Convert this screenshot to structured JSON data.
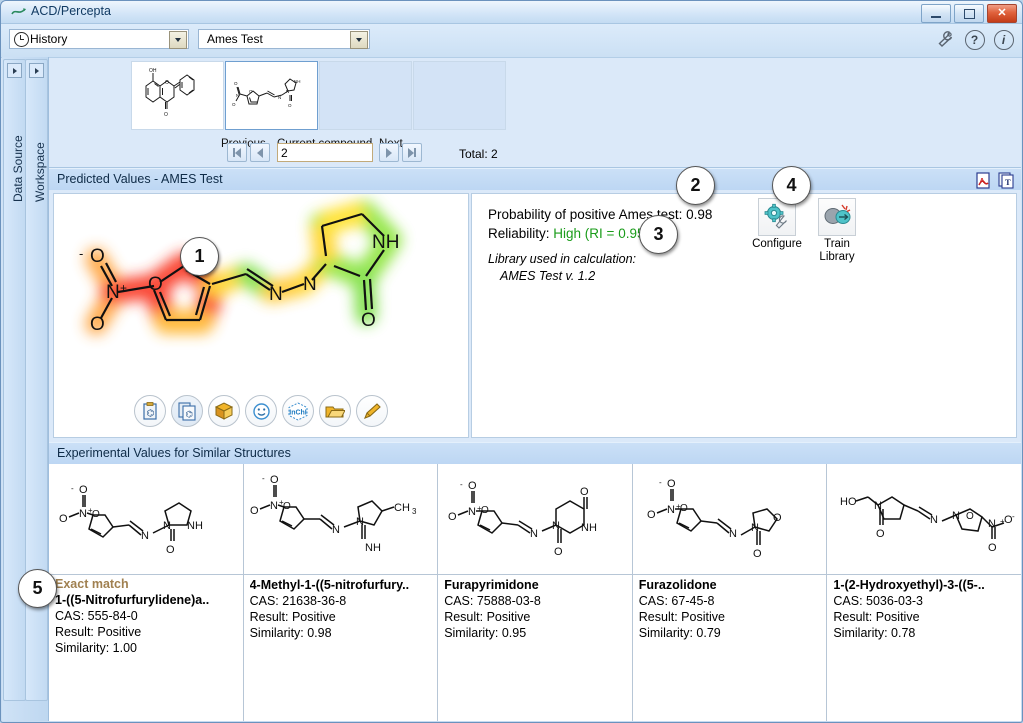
{
  "window": {
    "title": "ACD/Percepta",
    "buttons": {
      "minimize": "minimize",
      "maximize": "maximize",
      "close": "close"
    }
  },
  "toolbar": {
    "history_combo": "History",
    "test_combo": "Ames Test",
    "icons": [
      "wrench-icon",
      "help-icon",
      "info-icon"
    ]
  },
  "side_tabs": [
    {
      "label": "Data Source",
      "name": "sidebar-tab-data-source"
    },
    {
      "label": "Workspace",
      "name": "sidebar-tab-workspace"
    }
  ],
  "compound_strip": {
    "thumbnails": [
      {
        "name": "compound-thumbnail-1",
        "selected": false
      },
      {
        "name": "compound-thumbnail-2",
        "selected": true
      },
      {
        "name": "compound-thumbnail-3",
        "selected": false
      },
      {
        "name": "compound-thumbnail-4",
        "selected": false
      }
    ],
    "previous_label": "Previous",
    "current_label": "Current compound",
    "next_label": "Next",
    "current_value": "2",
    "total": "Total: 2"
  },
  "predicted_panel": {
    "title": "Predicted Values - AMES Test",
    "export_icons": [
      "pdf-export-icon",
      "report-export-icon"
    ],
    "probability_label": "Probability of positive Ames test:",
    "probability_value": "0.98",
    "reliability_label": "Reliability:",
    "reliability_value": "High (RI = 0.95)",
    "reliability_color": "#1a9c1a",
    "library_label": "Library used in calculation:",
    "library_value": "AMES Test v. 1.2",
    "configure_label": "Configure",
    "train_label": "Train Library",
    "structure_tools": [
      "paste-structure-icon",
      "copy-structure-icon",
      "dictionary-icon",
      "smiles-icon",
      "inchi-icon",
      "open-file-icon",
      "edit-structure-icon"
    ],
    "inchi_text": "InChI"
  },
  "experimental_panel": {
    "title": "Experimental Values for Similar Structures",
    "labels": {
      "cas": "CAS:",
      "result": "Result:",
      "similarity": "Similarity:"
    },
    "cards": [
      {
        "badge": "Exact match",
        "name": "1-((5-Nitrofurfurylidene)a..",
        "cas": "CAS: 555-84-0",
        "result": "Result: Positive",
        "similarity": "Similarity: 1.00"
      },
      {
        "badge": "",
        "name": "4-Methyl-1-((5-nitrofurfury..",
        "cas": "CAS: 21638-36-8",
        "result": "Result: Positive",
        "similarity": "Similarity: 0.98"
      },
      {
        "badge": "",
        "name": "Furapyrimidone",
        "cas": "CAS: 75888-03-8",
        "result": "Result: Positive",
        "similarity": "Similarity: 0.95"
      },
      {
        "badge": "",
        "name": "Furazolidone",
        "cas": "CAS: 67-45-8",
        "result": "Result: Positive",
        "similarity": "Similarity: 0.79"
      },
      {
        "badge": "",
        "name": "1-(2-Hydroxyethyl)-3-((5-..",
        "cas": "CAS: 5036-03-3",
        "result": "Result: Positive",
        "similarity": "Similarity: 0.78"
      }
    ]
  },
  "callouts": [
    {
      "number": "1"
    },
    {
      "number": "2"
    },
    {
      "number": "3"
    },
    {
      "number": "4"
    },
    {
      "number": "5"
    }
  ]
}
